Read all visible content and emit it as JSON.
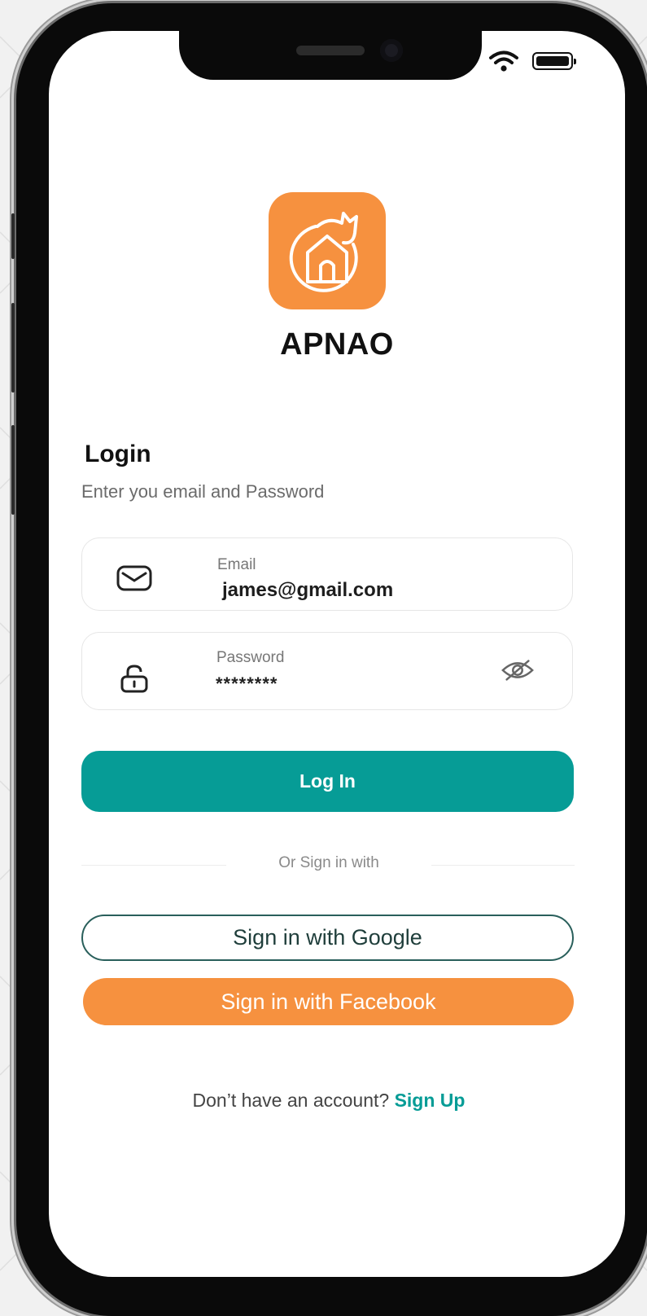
{
  "app": {
    "name": "APNAO",
    "brand_color": "#f6913f",
    "accent_color": "#069c96"
  },
  "status_bar": {
    "wifi_icon": "wifi-icon",
    "battery_icon": "battery-icon"
  },
  "login": {
    "title": "Login",
    "subtitle": "Enter you email and Password"
  },
  "email_field": {
    "label": "Email",
    "value": "james@gmail.com",
    "icon": "mail-icon"
  },
  "password_field": {
    "label": "Password",
    "value": "********",
    "icon": "lock-icon",
    "toggle_icon": "eye-slash-icon"
  },
  "buttons": {
    "login": "Log In",
    "google": "Sign in with Google",
    "facebook": "Sign in with Facebook"
  },
  "divider": {
    "text": "Or Sign in with"
  },
  "signup": {
    "prompt": "Don’t have an account?",
    "link": "Sign Up"
  }
}
